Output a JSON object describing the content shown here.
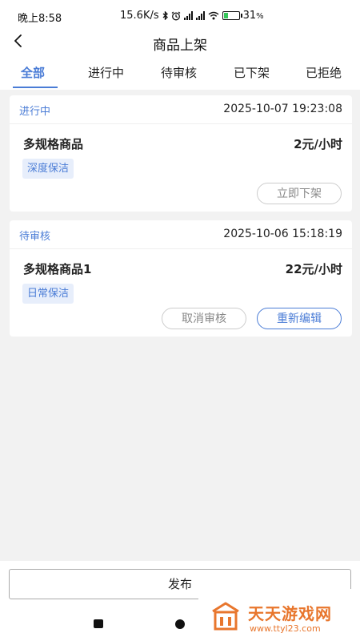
{
  "status_bar": {
    "time": "晚上8:58",
    "network_speed": "15.6K/s",
    "battery": "31",
    "battery_unit": "%",
    "battery_level": 0.31
  },
  "header": {
    "title": "商品上架",
    "back_icon": "chevron-left-icon"
  },
  "tabs": [
    {
      "label": "全部",
      "active": true
    },
    {
      "label": "进行中",
      "active": false
    },
    {
      "label": "待审核",
      "active": false
    },
    {
      "label": "已下架",
      "active": false
    },
    {
      "label": "已拒绝",
      "active": false
    }
  ],
  "cards": [
    {
      "status": "进行中",
      "time": "2025-10-07 19:23:08",
      "name": "多规格商品",
      "price": "2元/小时",
      "tag": "深度保洁",
      "actions": [
        {
          "label": "立即下架",
          "style": "gray"
        }
      ]
    },
    {
      "status": "待审核",
      "time": "2025-10-06 15:18:19",
      "name": "多规格商品1",
      "price": "22元/小时",
      "tag": "日常保洁",
      "actions": [
        {
          "label": "取消审核",
          "style": "gray"
        },
        {
          "label": "重新编辑",
          "style": "blue"
        }
      ]
    }
  ],
  "footer": {
    "publish_label": "发布"
  },
  "watermark": {
    "name": "天天游戏网",
    "url": "www.ttyl23.com"
  },
  "colors": {
    "accent": "#4a7cd6",
    "tag_bg": "#e7eefb",
    "page_bg": "#f2f2f2",
    "watermark": "#e8762d",
    "battery": "#35c75a"
  }
}
